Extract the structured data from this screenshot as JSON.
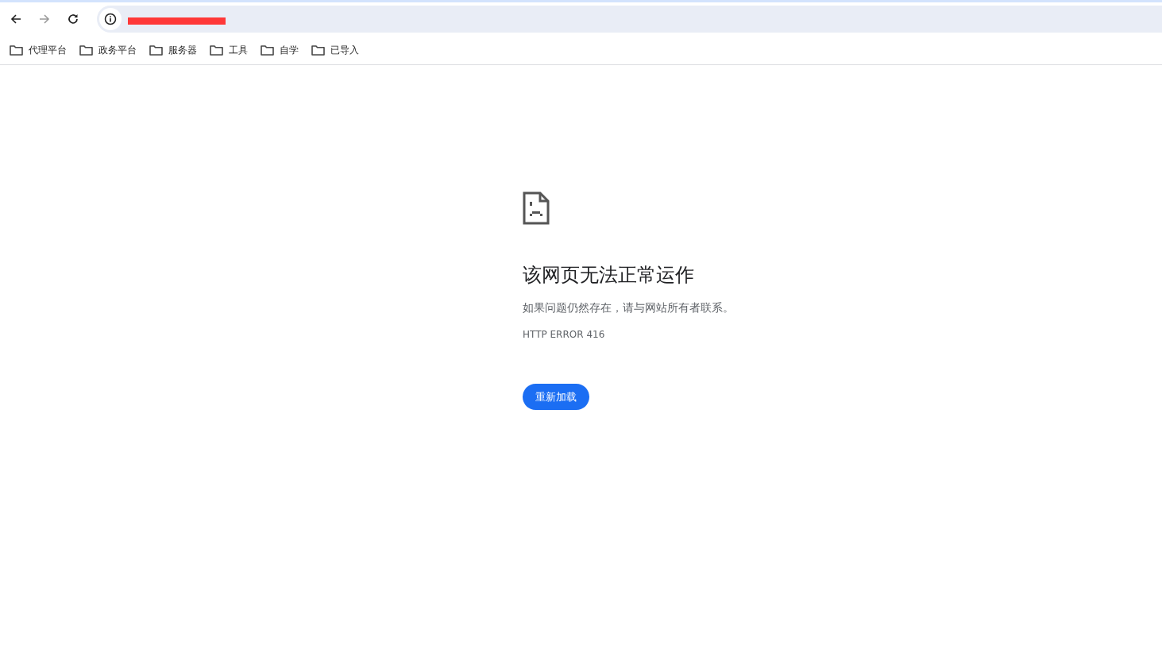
{
  "toolbar": {
    "back_disabled": false,
    "forward_disabled": true,
    "address_redacted": true
  },
  "bookmarks": [
    {
      "label": "代理平台"
    },
    {
      "label": "政务平台"
    },
    {
      "label": "服务器"
    },
    {
      "label": "工具"
    },
    {
      "label": "自学"
    },
    {
      "label": "已导入"
    }
  ],
  "error": {
    "title": "该网页无法正常运作",
    "message": "如果问题仍然存在，请与网站所有者联系。",
    "code": "HTTP ERROR 416",
    "button": "重新加载"
  }
}
